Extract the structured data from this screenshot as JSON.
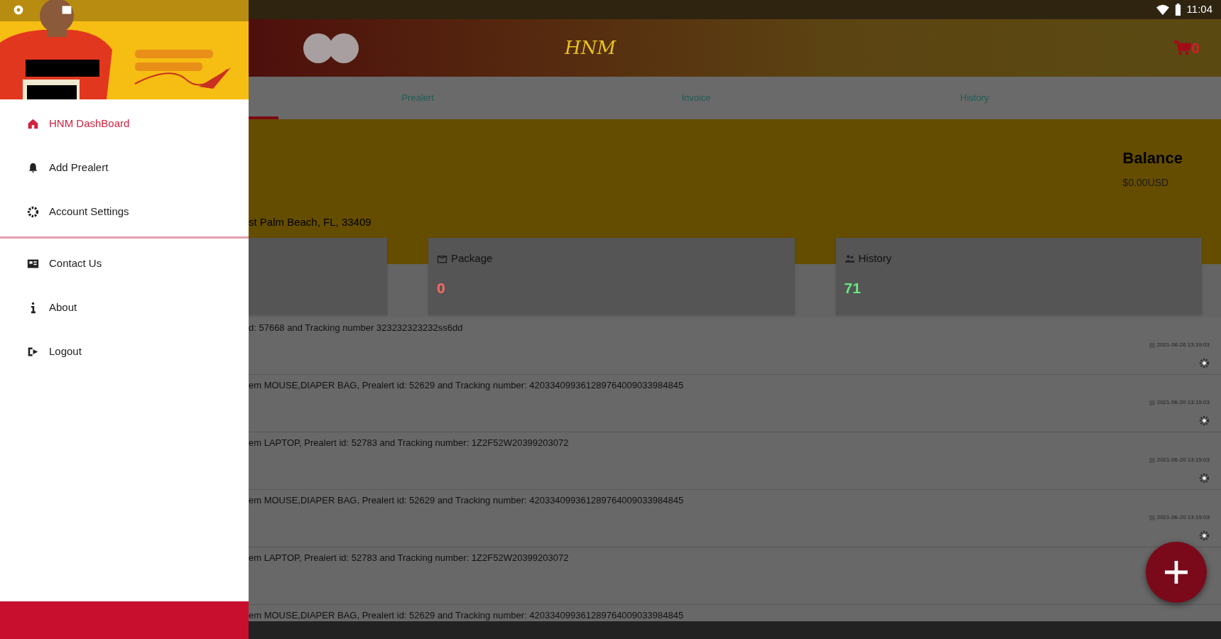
{
  "status_bar": {
    "time": "11:04"
  },
  "drawer": {
    "groups": [
      {
        "items": [
          {
            "label": "HNM DashBoard",
            "selected": true
          },
          {
            "label": "Add Prealert",
            "selected": false
          },
          {
            "label": "Account Settings",
            "selected": false
          }
        ]
      },
      {
        "items": [
          {
            "label": "Contact Us",
            "selected": false
          },
          {
            "label": "About",
            "selected": false
          },
          {
            "label": "Logout",
            "selected": false
          }
        ]
      }
    ]
  },
  "app_bar": {
    "logo": "HNM",
    "cart_count": "0"
  },
  "tabs": {
    "first_selected": true,
    "items": [
      {
        "label": "Prealert",
        "selected": false
      },
      {
        "label": "Invoice",
        "selected": false
      },
      {
        "label": "History",
        "selected": false
      }
    ]
  },
  "account": {
    "address": "st Palm Beach, FL, 33409",
    "balance_label": "Balance",
    "balance": "$0.00USD"
  },
  "cards": [
    {
      "kind": "blank"
    },
    {
      "kind": "stat",
      "title": "Package",
      "value": "0",
      "color": "#ff6b63"
    },
    {
      "kind": "stat",
      "title": "History",
      "value": "71",
      "color": "#66e880"
    }
  ],
  "prealerts": [
    {
      "text": "d: 57668 and Tracking number 323232323232ss6dd",
      "date": "2021-06-26 13:19:03"
    },
    {
      "text": "em MOUSE,DIAPER BAG, Prealert id: 52629 and Tracking number: 420334099361289764009033984845",
      "date": "2021-06-20 13:15:03"
    },
    {
      "text": "em LAPTOP, Prealert id: 52783 and Tracking number: 1Z2F52W20399203072",
      "date": "2021-06-20 13:15:03"
    },
    {
      "text": "em MOUSE,DIAPER BAG, Prealert id: 52629 and Tracking number: 420334099361289764009033984845",
      "date": "2021-06-20 13:15:03"
    },
    {
      "text": "em LAPTOP, Prealert id: 52783 and Tracking number: 1Z2F52W20399203072"
    },
    {
      "text": "em MOUSE,DIAPER BAG, Prealert id: 52629 and Tracking number: 420334099361289764009033984845"
    }
  ]
}
